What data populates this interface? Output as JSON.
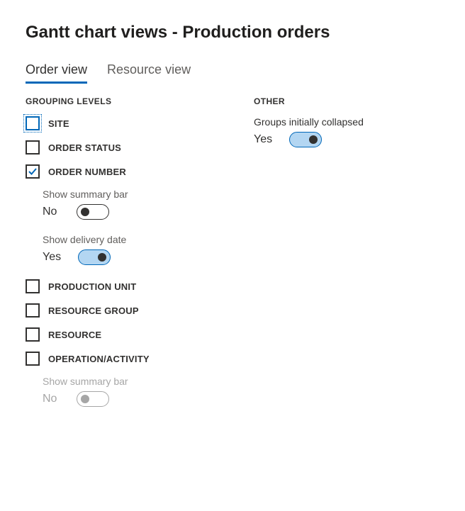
{
  "title": "Gantt chart views - Production orders",
  "tabs": {
    "orderView": "Order view",
    "resourceView": "Resource view"
  },
  "sections": {
    "groupingLevels": "GROUPING LEVELS",
    "other": "OTHER"
  },
  "items": {
    "site": "SITE",
    "orderStatus": "ORDER STATUS",
    "orderNumber": "ORDER NUMBER",
    "productionUnit": "PRODUCTION UNIT",
    "resourceGroup": "RESOURCE GROUP",
    "resource": "RESOURCE",
    "operationActivity": "OPERATION/ACTIVITY"
  },
  "subs": {
    "showSummaryBar": "Show summary bar",
    "showDeliveryDate": "Show delivery date",
    "groupsInitiallyCollapsed": "Groups initially collapsed"
  },
  "toggleValues": {
    "summaryBar1": "No",
    "deliveryDate": "Yes",
    "summaryBar2": "No",
    "groupsCollapsed": "Yes"
  }
}
